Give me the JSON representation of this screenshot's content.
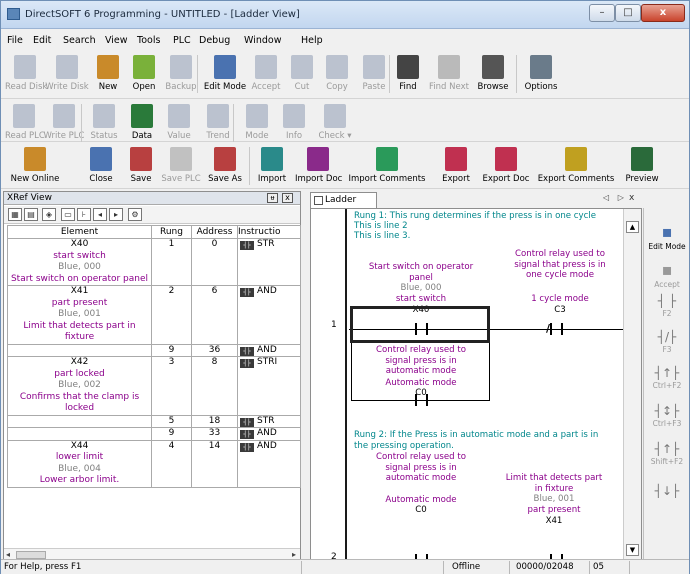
{
  "window": {
    "title": "DirectSOFT 6 Programming - UNTITLED - [Ladder View]",
    "min": "–",
    "max": "□",
    "close": "x"
  },
  "menu": [
    "File",
    "Edit",
    "Search",
    "View",
    "Tools",
    "PLC",
    "Debug",
    "Window",
    "Help"
  ],
  "toolbar1": [
    {
      "label": "Read Disk",
      "enabled": false,
      "icon": "read-disk-icon"
    },
    {
      "label": "Write Disk",
      "enabled": false,
      "icon": "write-disk-icon"
    },
    {
      "label": "New",
      "enabled": true,
      "icon": "new-document-icon"
    },
    {
      "label": "Open",
      "enabled": true,
      "icon": "open-folder-icon"
    },
    {
      "label": "Backup",
      "enabled": false,
      "icon": "backup-icon"
    },
    {
      "label": "Edit Mode",
      "enabled": true,
      "icon": "edit-mode-icon"
    },
    {
      "label": "Accept",
      "enabled": false,
      "icon": "accept-icon"
    },
    {
      "label": "Cut",
      "enabled": false,
      "icon": "cut-icon"
    },
    {
      "label": "Copy",
      "enabled": false,
      "icon": "copy-icon"
    },
    {
      "label": "Paste",
      "enabled": false,
      "icon": "paste-icon"
    },
    {
      "label": "Find",
      "enabled": true,
      "icon": "binoculars-icon"
    },
    {
      "label": "Find Next",
      "enabled": false,
      "icon": "find-next-icon"
    },
    {
      "label": "Browse",
      "enabled": true,
      "icon": "browse-icon"
    },
    {
      "label": "Options",
      "enabled": true,
      "icon": "options-icon"
    }
  ],
  "toolbar2": [
    {
      "label": "Read PLC",
      "enabled": false,
      "icon": "read-plc-icon"
    },
    {
      "label": "Write PLC",
      "enabled": false,
      "icon": "write-plc-icon"
    },
    {
      "label": "Status",
      "enabled": false,
      "icon": "status-icon"
    },
    {
      "label": "Data",
      "enabled": true,
      "icon": "data-icon"
    },
    {
      "label": "Value",
      "enabled": false,
      "icon": "value-icon"
    },
    {
      "label": "Trend",
      "enabled": false,
      "icon": "trend-icon"
    },
    {
      "label": "Mode",
      "enabled": false,
      "icon": "mode-icon"
    },
    {
      "label": "Info",
      "enabled": false,
      "icon": "info-icon"
    },
    {
      "label": "Check",
      "enabled": false,
      "icon": "check-icon",
      "dropdown": "▾"
    }
  ],
  "toolbar3": [
    {
      "label": "New Online",
      "enabled": true,
      "icon": "new-online-icon"
    },
    {
      "label": "Close",
      "enabled": true,
      "icon": "close-icon"
    },
    {
      "label": "Save",
      "enabled": true,
      "icon": "save-icon"
    },
    {
      "label": "Save PLC",
      "enabled": false,
      "icon": "save-plc-icon"
    },
    {
      "label": "Save As",
      "enabled": true,
      "icon": "save-as-icon"
    },
    {
      "label": "Import",
      "enabled": true,
      "icon": "import-icon"
    },
    {
      "label": "Import Doc",
      "enabled": true,
      "icon": "import-doc-icon"
    },
    {
      "label": "Import Comments",
      "enabled": true,
      "icon": "import-comments-icon"
    },
    {
      "label": "Export",
      "enabled": true,
      "icon": "export-icon"
    },
    {
      "label": "Export Doc",
      "enabled": true,
      "icon": "export-doc-icon"
    },
    {
      "label": "Export Comments",
      "enabled": true,
      "icon": "export-comments-icon"
    },
    {
      "label": "Preview",
      "enabled": true,
      "icon": "preview-icon"
    }
  ],
  "xref": {
    "title": "XRef View",
    "pin": "ᵾ",
    "close": "x",
    "headers": [
      "Element",
      "Rung",
      "Address",
      "Instructio"
    ],
    "rows": [
      {
        "name": "X40",
        "nick": "start switch",
        "addr": "Blue, 000",
        "desc": "Start switch on operator panel",
        "rung": "1",
        "address": "0",
        "instr": "STR"
      },
      {
        "name": "X41",
        "nick": "part present",
        "addr": "Blue, 001",
        "desc": "Limit that detects part in fixture",
        "rung": "2",
        "address": "6",
        "instr": "AND"
      },
      {
        "name": "",
        "nick": "",
        "addr": "",
        "desc": "",
        "rung": "9",
        "address": "36",
        "instr": "AND"
      },
      {
        "name": "X42",
        "nick": "part locked",
        "addr": "Blue, 002",
        "desc": "Confirms that the clamp is locked",
        "rung": "3",
        "address": "8",
        "instr": "STRI"
      },
      {
        "name": "",
        "nick": "",
        "addr": "",
        "desc": "",
        "rung": "5",
        "address": "18",
        "instr": "STR"
      },
      {
        "name": "",
        "nick": "",
        "addr": "",
        "desc": "",
        "rung": "9",
        "address": "33",
        "instr": "AND"
      },
      {
        "name": "X44",
        "nick": "lower limit",
        "addr": "Blue, 004",
        "desc": "Lower arbor limit.",
        "rung": "4",
        "address": "14",
        "instr": "AND"
      }
    ]
  },
  "ladder": {
    "tab": "Ladder View",
    "rung1_comment": [
      "Rung 1: This rung determines if the press is in one cycle",
      "This is line 2",
      "This is line 3."
    ],
    "c1": {
      "desc": [
        "Start switch on operator",
        "panel"
      ],
      "addr": "Blue, 000",
      "nick": "start switch",
      "name": "X40"
    },
    "c3": {
      "desc": [
        "Control relay used to",
        "signal that press is in",
        "one cycle mode"
      ],
      "nick": "1 cycle mode",
      "name": "C3"
    },
    "c0": {
      "desc": [
        "Control relay used to",
        "signal press is in",
        "automatic mode"
      ],
      "nick": "Automatic mode",
      "name": "C0"
    },
    "rung2_comment": [
      "Rung 2: If the Press is in automatic mode and a part is in",
      "the pressing operation."
    ],
    "r2c0": {
      "desc": [
        "Control relay used to",
        "signal press is in",
        "automatic mode"
      ],
      "nick": "Automatic mode",
      "name": "C0"
    },
    "r2x41": {
      "desc": [
        "Limit that detects part",
        "in fixture"
      ],
      "addr": "Blue, 001",
      "nick": "part present",
      "name": "X41"
    },
    "rung_numbers": [
      "1",
      "2"
    ],
    "nav": "◁ ▷",
    "close": "x"
  },
  "instr_panel": [
    {
      "label": "Edit Mode",
      "glyph": "",
      "enabled": true
    },
    {
      "label": "Accept",
      "glyph": "",
      "enabled": false
    },
    {
      "label": "F2",
      "glyph": "┤ ├",
      "enabled": false
    },
    {
      "label": "F3",
      "glyph": "┤/├",
      "enabled": false
    },
    {
      "label": "Ctrl+F2",
      "glyph": "┤↑├",
      "enabled": false
    },
    {
      "label": "Ctrl+F3",
      "glyph": "┤↕├",
      "enabled": false
    },
    {
      "label": "Shift+F2",
      "glyph": "┤↑├",
      "enabled": false
    },
    {
      "label": "",
      "glyph": "┤↓├",
      "enabled": false
    }
  ],
  "status": {
    "help": "For Help, press F1",
    "mode": "Offline",
    "memory": "00000/02048",
    "cpu": "05"
  }
}
